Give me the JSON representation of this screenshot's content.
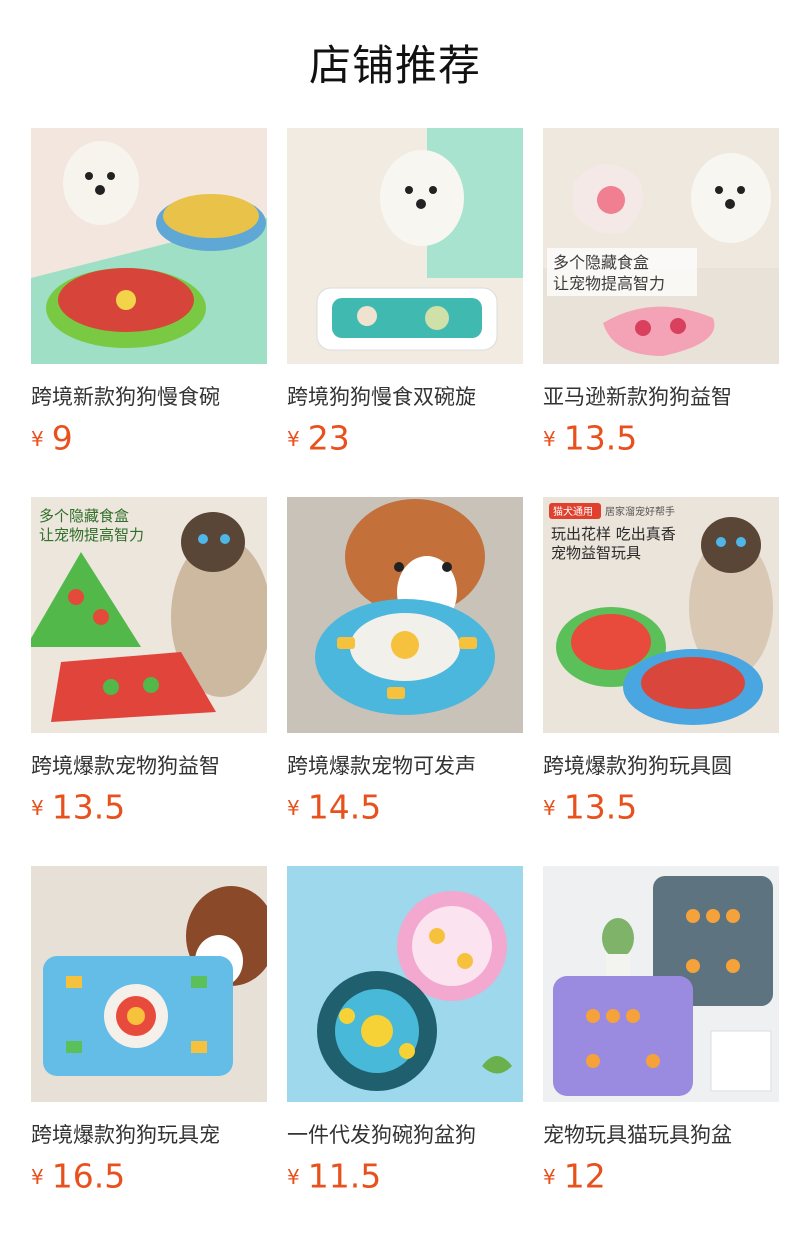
{
  "page": {
    "title": "店铺推荐"
  },
  "currency_symbol": "¥",
  "colors": {
    "price": "#e8511d",
    "title": "#111111",
    "product_title": "#333333"
  },
  "products": [
    {
      "title": "跨境新款狗狗慢食碗",
      "price": "9",
      "image_icon": "dog-slow-feeder-bowl-photo"
    },
    {
      "title": "跨境狗狗慢食双碗旋",
      "price": "23",
      "image_icon": "dog-double-slow-bowl-photo"
    },
    {
      "title": "亚马逊新款狗狗益智",
      "price": "13.5",
      "image_icon": "dog-puzzle-toy-photo",
      "overlay": [
        "多个隐藏食盒",
        "让宠物提高智力"
      ]
    },
    {
      "title": "跨境爆款宠物狗益智",
      "price": "13.5",
      "image_icon": "cat-tree-puzzle-photo",
      "overlay": [
        "多个隐藏食盒",
        "让宠物提高智力"
      ]
    },
    {
      "title": "跨境爆款宠物可发声",
      "price": "14.5",
      "image_icon": "corgi-round-puzzle-photo"
    },
    {
      "title": "跨境爆款狗狗玩具圆",
      "price": "13.5",
      "image_icon": "cat-round-puzzle-photo",
      "overlay": [
        "玩出花样 吃出真香",
        "宠物益智玩具"
      ],
      "tags": [
        "猫犬通用",
        "居家溜宠好帮手"
      ]
    },
    {
      "title": "跨境爆款狗狗玩具宠",
      "price": "16.5",
      "image_icon": "dog-rect-puzzle-photo"
    },
    {
      "title": "一件代发狗碗狗盆狗",
      "price": "11.5",
      "image_icon": "round-puzzle-plates-photo"
    },
    {
      "title": "宠物玩具猫玩具狗盆",
      "price": "12",
      "image_icon": "square-puzzle-boards-photo"
    }
  ]
}
